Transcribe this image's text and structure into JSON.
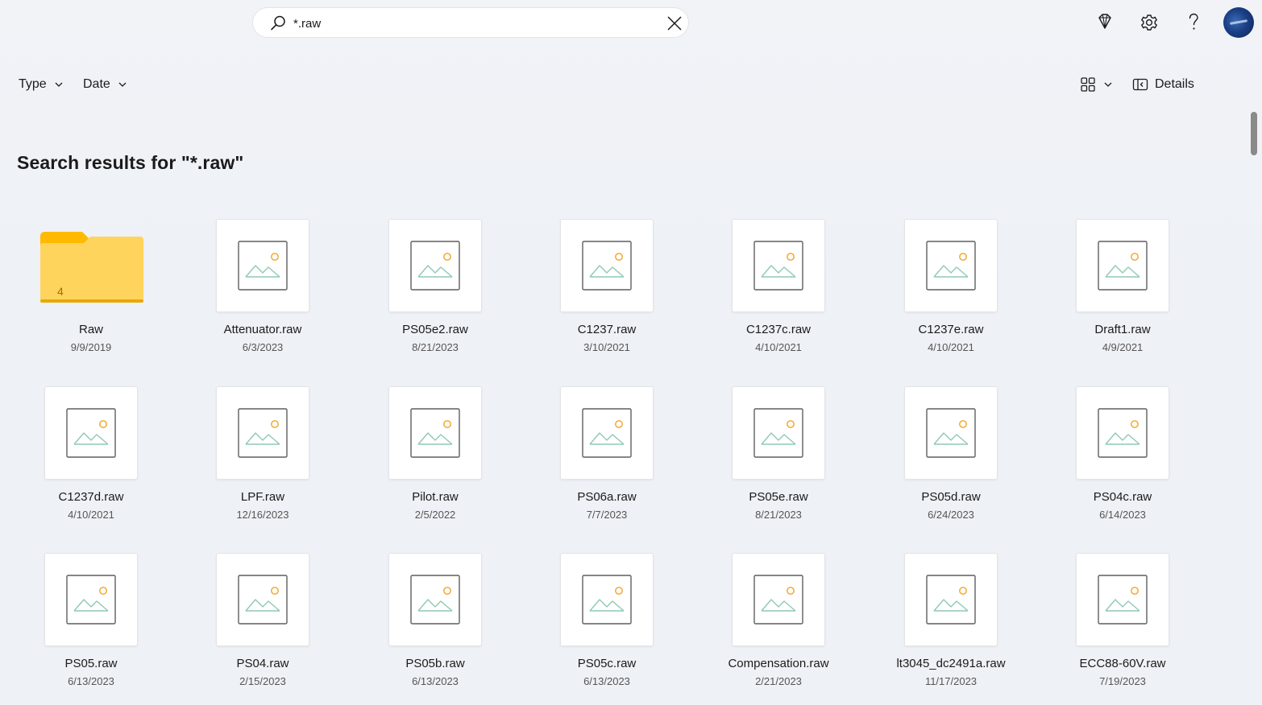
{
  "search": {
    "value": "*.raw",
    "placeholder": ""
  },
  "toolbar": {
    "premium_icon": "diamond-icon",
    "settings_icon": "gear-icon",
    "help_icon": "question-icon"
  },
  "filters": {
    "type_label": "Type",
    "date_label": "Date",
    "details_label": "Details"
  },
  "heading": "Search results for \"*.raw\"",
  "colors": {
    "folder": "#ffce4a",
    "accent_sun": "#f2a321",
    "mountain": "#8fc9b3"
  },
  "items": [
    {
      "name": "Raw",
      "date": "9/9/2019",
      "kind": "folder",
      "count": "4"
    },
    {
      "name": "Attenuator.raw",
      "date": "6/3/2023",
      "kind": "image"
    },
    {
      "name": "PS05e2.raw",
      "date": "8/21/2023",
      "kind": "image"
    },
    {
      "name": "C1237.raw",
      "date": "3/10/2021",
      "kind": "image"
    },
    {
      "name": "C1237c.raw",
      "date": "4/10/2021",
      "kind": "image"
    },
    {
      "name": "C1237e.raw",
      "date": "4/10/2021",
      "kind": "image"
    },
    {
      "name": "Draft1.raw",
      "date": "4/9/2021",
      "kind": "image"
    },
    {
      "name": "C1237d.raw",
      "date": "4/10/2021",
      "kind": "image"
    },
    {
      "name": "LPF.raw",
      "date": "12/16/2023",
      "kind": "image"
    },
    {
      "name": "Pilot.raw",
      "date": "2/5/2022",
      "kind": "image"
    },
    {
      "name": "PS06a.raw",
      "date": "7/7/2023",
      "kind": "image"
    },
    {
      "name": "PS05e.raw",
      "date": "8/21/2023",
      "kind": "image"
    },
    {
      "name": "PS05d.raw",
      "date": "6/24/2023",
      "kind": "image"
    },
    {
      "name": "PS04c.raw",
      "date": "6/14/2023",
      "kind": "image"
    },
    {
      "name": "PS05.raw",
      "date": "6/13/2023",
      "kind": "image"
    },
    {
      "name": "PS04.raw",
      "date": "2/15/2023",
      "kind": "image"
    },
    {
      "name": "PS05b.raw",
      "date": "6/13/2023",
      "kind": "image"
    },
    {
      "name": "PS05c.raw",
      "date": "6/13/2023",
      "kind": "image"
    },
    {
      "name": "Compensation.raw",
      "date": "2/21/2023",
      "kind": "image"
    },
    {
      "name": "lt3045_dc2491a.raw",
      "date": "11/17/2023",
      "kind": "image"
    },
    {
      "name": "ECC88-60V.raw",
      "date": "7/19/2023",
      "kind": "image"
    }
  ]
}
